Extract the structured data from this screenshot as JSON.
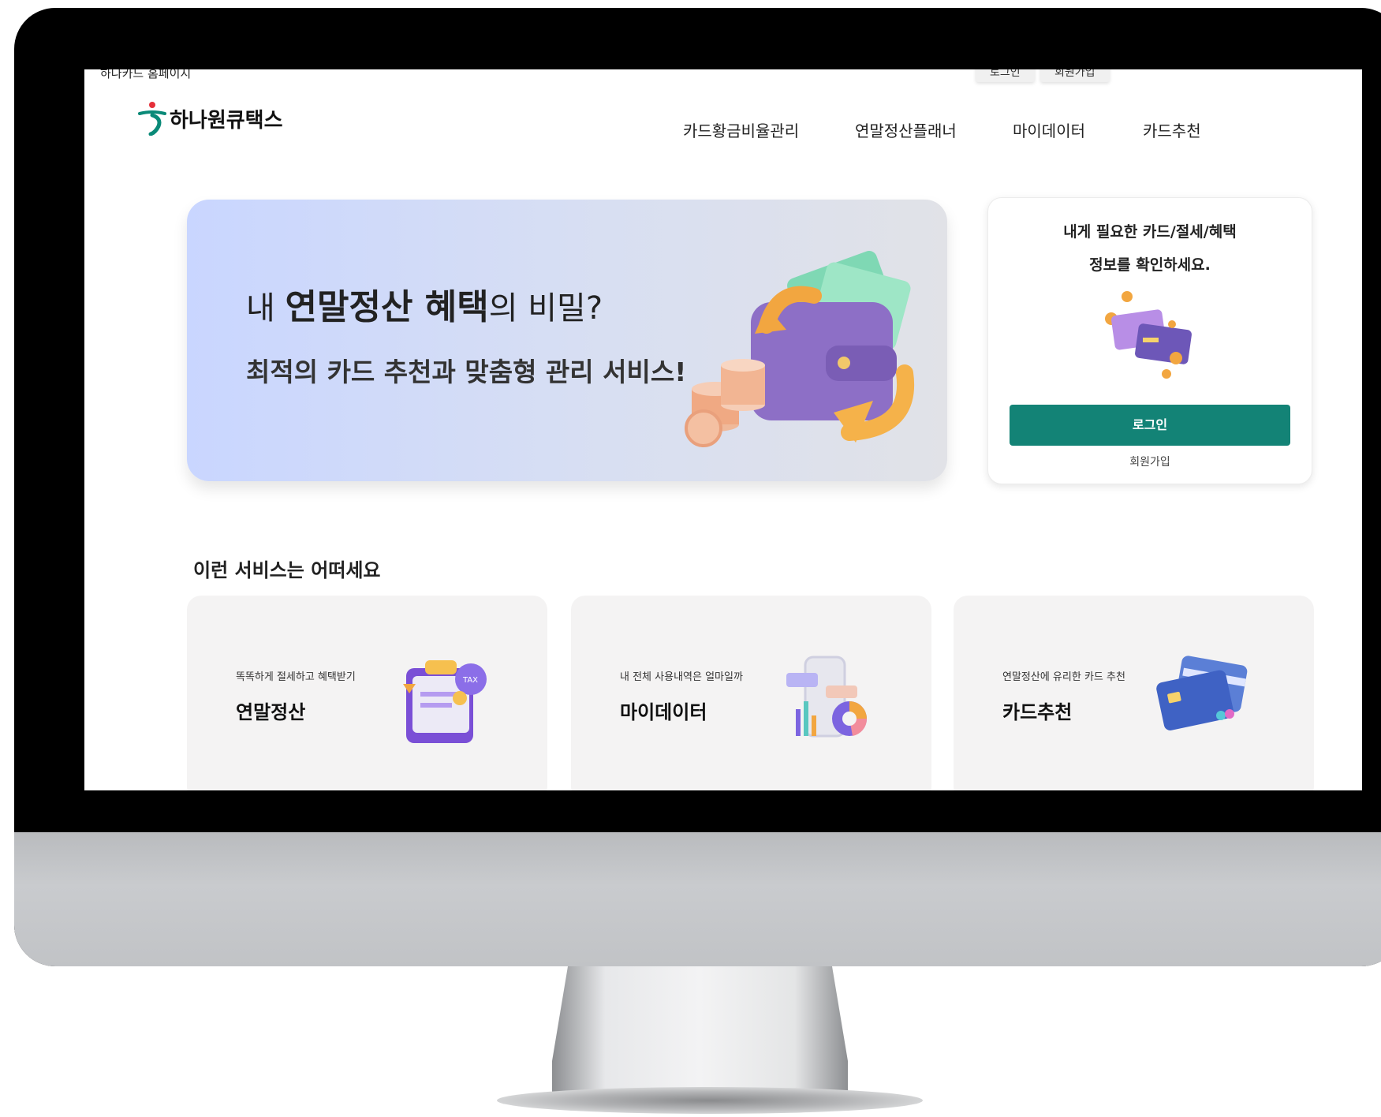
{
  "topbar": {
    "left_link": "하나카드 홈페이지",
    "login_label": "로그인",
    "signup_label": "회원가입"
  },
  "brand": {
    "name": "하나원큐택스",
    "accent": "#138376",
    "logo_color": "#0a8a78",
    "logo_dot": "#e5303a"
  },
  "nav": {
    "items": [
      "카드황금비율관리",
      "연말정산플래너",
      "마이데이터",
      "카드추천"
    ]
  },
  "hero": {
    "title_prefix": "내 ",
    "title_bold": "연말정산 혜택",
    "title_suffix": "의 비밀?",
    "subtitle": "최적의 카드 추천과 맞춤형 관리 서비스!",
    "image_icon": "wallet-money-illustration"
  },
  "login_card": {
    "line1": "내게 필요한 카드/절세/혜택",
    "line2": "정보를 확인하세요.",
    "image_icon": "cards-coins-illustration",
    "login_button": "로그인",
    "signup_link": "회원가입"
  },
  "services": {
    "title": "이런 서비스는 어떠세요",
    "cards": [
      {
        "subtitle": "똑똑하게 절세하고 혜택받기",
        "title": "연말정산",
        "icon": "tax-clipboard-icon"
      },
      {
        "subtitle": "내 전체 사용내역은 얼마일까",
        "title": "마이데이터",
        "icon": "phone-chart-icon"
      },
      {
        "subtitle": "연말정산에 유리한 카드 추천",
        "title": "카드추천",
        "icon": "credit-cards-icon"
      }
    ]
  }
}
